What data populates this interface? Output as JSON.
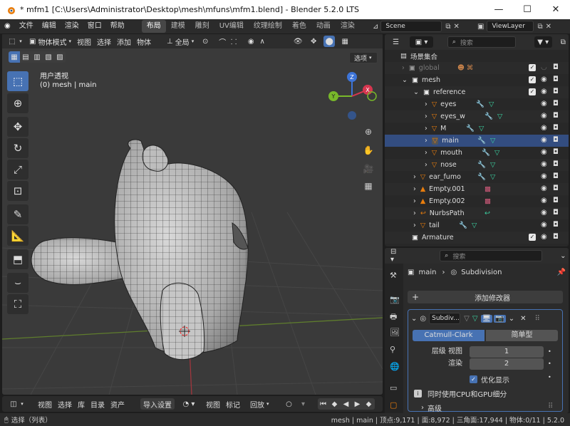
{
  "titlebar": {
    "title": "* mfm1 [C:\\Users\\Administrator\\Desktop\\mesh\\mfuns\\mfm1.blend] - Blender 5.2.0 LTS"
  },
  "menus": [
    "文件",
    "编辑",
    "渲染",
    "窗口",
    "帮助"
  ],
  "workspaces": [
    "布局",
    "建模",
    "雕刻",
    "UV编辑",
    "纹理绘制",
    "着色",
    "动画",
    "渲染"
  ],
  "active_workspace": "布局",
  "scene": "Scene",
  "viewlayer": "ViewLayer",
  "viewport": {
    "mode": "物体模式",
    "menu": [
      "视图",
      "选择",
      "添加",
      "物体"
    ],
    "transform": "全局",
    "options": "选项",
    "view_name": "用户透视",
    "view_subtitle": "(0) mesh | main",
    "axis": {
      "x": "X",
      "y": "Y",
      "z": "Z"
    }
  },
  "outliner": {
    "search_placeholder": "搜索",
    "rows": [
      {
        "label": "场景集合",
        "depth": 0
      },
      {
        "label": "global",
        "depth": 1,
        "dim": true
      },
      {
        "label": "mesh",
        "depth": 1
      },
      {
        "label": "reference",
        "depth": 2
      },
      {
        "label": "eyes",
        "depth": 3
      },
      {
        "label": "eyes_w",
        "depth": 3
      },
      {
        "label": "M",
        "depth": 3
      },
      {
        "label": "main",
        "depth": 3
      },
      {
        "label": "mouth",
        "depth": 3
      },
      {
        "label": "nose",
        "depth": 3
      },
      {
        "label": "ear_fumo",
        "depth": 2
      },
      {
        "label": "Empty.001",
        "depth": 2
      },
      {
        "label": "Empty.002",
        "depth": 2
      },
      {
        "label": "NurbsPath",
        "depth": 2
      },
      {
        "label": "tail",
        "depth": 2
      },
      {
        "label": "Armature",
        "depth": 1
      }
    ]
  },
  "properties": {
    "search_placeholder": "搜索",
    "breadcrumb_object": "main",
    "breadcrumb_modifier": "Subdivision",
    "add_modifier": "添加修改器",
    "modifier_name": "Subdiv...",
    "method_active": "Catmull-Clark",
    "method_other": "简单型",
    "levels_label": "层级 视图",
    "levels_value": "1",
    "render_label": "渲染",
    "render_value": "2",
    "optimal_label": "优化显示",
    "gpu_label": "同时使用CPU和GPU细分",
    "advanced_label": "高级"
  },
  "timeline": {
    "menu": [
      "视图",
      "选择",
      "库",
      "目录",
      "资产"
    ],
    "import": "导入设置",
    "menu2": [
      "视图",
      "标记"
    ],
    "playback": "回放"
  },
  "statusbar": {
    "left": "选择（列表）",
    "right": "mesh | main | 顶点:9,171 | 面:8,972 | 三角面:17,944 | 物体:0/11 | 5.2.0"
  },
  "colors": {
    "accent": "#4772b3",
    "selected_row": "#334d80",
    "collection_icon": "#e87d0d"
  }
}
